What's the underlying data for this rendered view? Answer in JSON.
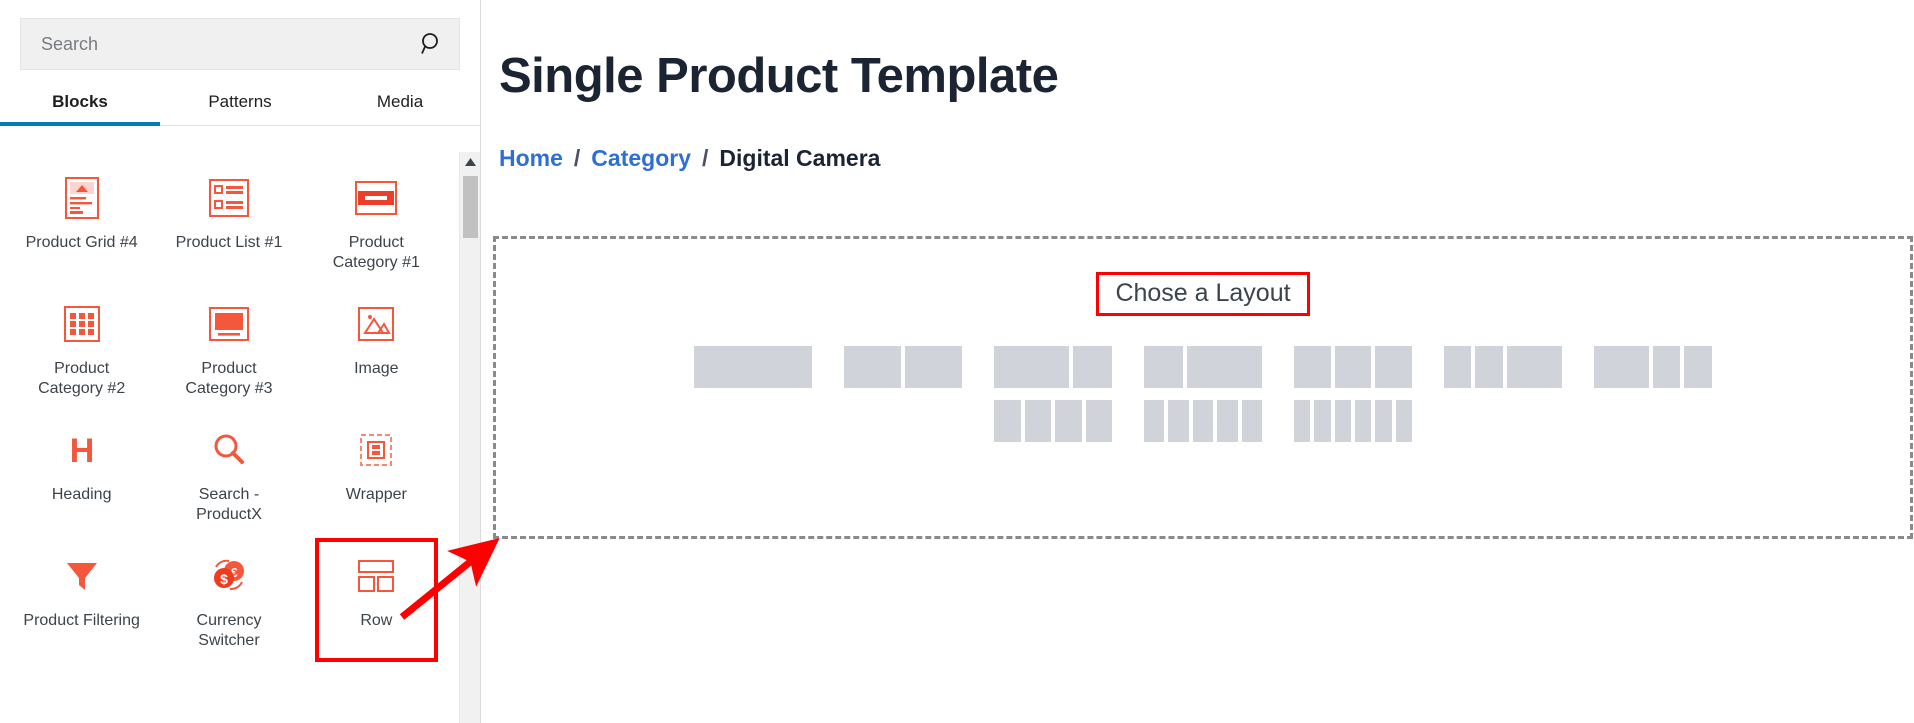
{
  "inserter": {
    "search": {
      "value": "",
      "placeholder": "Search",
      "icon": "search-icon"
    },
    "tabs": [
      {
        "label": "Blocks",
        "active": true
      },
      {
        "label": "Patterns",
        "active": false
      },
      {
        "label": "Media",
        "active": false
      }
    ],
    "blocks": [
      {
        "label": "Product Grid #4",
        "icon": "product-grid-icon",
        "highlighted": false
      },
      {
        "label": "Product List #1",
        "icon": "product-list-icon",
        "highlighted": false
      },
      {
        "label": "Product Category #1",
        "icon": "product-category-1-icon",
        "highlighted": false
      },
      {
        "label": "Product Category #2",
        "icon": "product-category-2-icon",
        "highlighted": false
      },
      {
        "label": "Product Category #3",
        "icon": "product-category-3-icon",
        "highlighted": false
      },
      {
        "label": "Image",
        "icon": "image-icon",
        "highlighted": false
      },
      {
        "label": "Heading",
        "icon": "heading-icon",
        "highlighted": false
      },
      {
        "label": "Search - ProductX",
        "icon": "search-productx-icon",
        "highlighted": false
      },
      {
        "label": "Wrapper",
        "icon": "wrapper-icon",
        "highlighted": false
      },
      {
        "label": "Product Filtering",
        "icon": "funnel-icon",
        "highlighted": false
      },
      {
        "label": "Currency Switcher",
        "icon": "currency-switcher-icon",
        "highlighted": false
      },
      {
        "label": "Row",
        "icon": "row-icon",
        "highlighted": true
      }
    ],
    "scrollbar": {
      "up_arrow": "triangle-up-icon"
    }
  },
  "canvas": {
    "title": "Single Product Template",
    "breadcrumb": {
      "items": [
        {
          "label": "Home",
          "link": true
        },
        {
          "label": "Category",
          "link": true
        },
        {
          "label": "Digital Camera",
          "link": false
        }
      ],
      "separator": "/"
    },
    "dropzone": {
      "prompt": "Chose a Layout",
      "variations": [
        {
          "name": "1-column",
          "columns": [
            100
          ]
        },
        {
          "name": "2-column-equal",
          "columns": [
            50,
            50
          ]
        },
        {
          "name": "2-column-wide-left",
          "columns": [
            66,
            34
          ]
        },
        {
          "name": "2-column-wide-right",
          "columns": [
            34,
            66
          ]
        },
        {
          "name": "3-column-equal",
          "columns": [
            33,
            33,
            33
          ]
        },
        {
          "name": "3-column-wide-right",
          "columns": [
            25,
            25,
            50
          ]
        },
        {
          "name": "3-column-wide-left",
          "columns": [
            50,
            25,
            25
          ]
        },
        {
          "name": "4-column-equal",
          "columns": [
            25,
            25,
            25,
            25
          ]
        },
        {
          "name": "5-column-equal",
          "columns": [
            20,
            20,
            20,
            20,
            20
          ]
        },
        {
          "name": "6-column-equal",
          "columns": [
            17,
            17,
            17,
            17,
            17,
            17
          ]
        }
      ],
      "rows": [
        7,
        3
      ]
    }
  },
  "annotations": {
    "highlight_color": "#ff0000",
    "arrow": {
      "from": "row-block",
      "to": "layout-dropzone"
    }
  },
  "colors": {
    "accent_blue": "#007cba",
    "link_blue": "#2e6fd4",
    "brand_orange": "#ff5a3c",
    "placeholder_gray": "#d0d3da",
    "title_navy": "#1b2432"
  }
}
